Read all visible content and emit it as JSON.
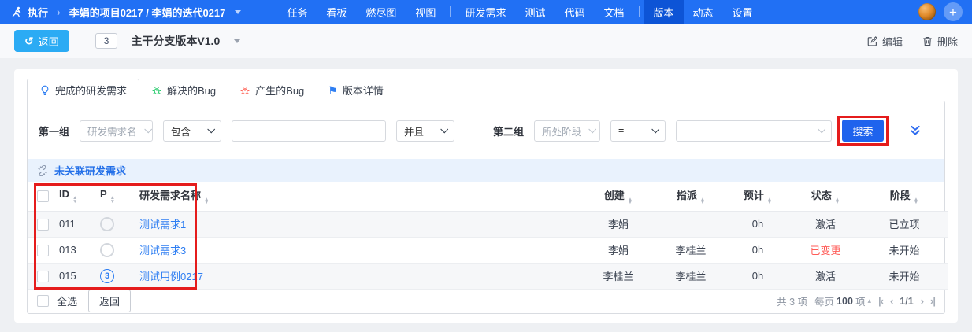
{
  "colors": {
    "navbar": "#2170f4",
    "navbar_active": "#0d54d6",
    "back_button": "#2babf4",
    "search_button": "#1f63ed",
    "link": "#2e7ef2",
    "status_changed": "#ff5b57",
    "section_bar_bg": "#e9f2fd",
    "annotation": "#e51c1c"
  },
  "navbar": {
    "section_label": "执行",
    "breadcrumb": "李娟的项目0217 / 李娟的迭代0217",
    "menu": [
      "任务",
      "看板",
      "燃尽图",
      "视图",
      "研发需求",
      "测试",
      "代码",
      "文档",
      "版本",
      "动态",
      "设置"
    ],
    "active_item": "版本"
  },
  "toolbar": {
    "back_label": "返回",
    "count_badge": "3",
    "version_title": "主干分支版本V1.0",
    "edit_label": "编辑",
    "delete_label": "删除"
  },
  "tabs": [
    {
      "label": "完成的研发需求",
      "icon": "bulb-icon",
      "active": true
    },
    {
      "label": "解决的Bug",
      "icon": "bug-green-icon",
      "active": false
    },
    {
      "label": "产生的Bug",
      "icon": "bug-red-icon",
      "active": false
    },
    {
      "label": "版本详情",
      "icon": "flag-icon",
      "active": false
    }
  ],
  "filter": {
    "group1": {
      "label": "第一组",
      "field": "研发需求名",
      "operator": "包含",
      "value": "",
      "join": "并且"
    },
    "group2": {
      "label": "第二组",
      "field": "所处阶段",
      "operator": "=",
      "value": ""
    },
    "search_label": "搜索"
  },
  "section": {
    "title": "未关联研发需求"
  },
  "table": {
    "headers": {
      "id": "ID",
      "p": "P",
      "name": "研发需求名称",
      "created": "创建",
      "assigned": "指派",
      "estimate": "预计",
      "status": "状态",
      "stage": "阶段"
    },
    "rows": [
      {
        "id": "011",
        "p": "",
        "name": "测试需求1",
        "created": "李娟",
        "assigned": "",
        "estimate": "0h",
        "status": "激活",
        "stage": "已立项"
      },
      {
        "id": "013",
        "p": "",
        "name": "测试需求3",
        "created": "李娟",
        "assigned": "李桂兰",
        "estimate": "0h",
        "status": "已变更",
        "stage": "未开始"
      },
      {
        "id": "015",
        "p": "3",
        "name": "测试用例0217",
        "created": "李桂兰",
        "assigned": "李桂兰",
        "estimate": "0h",
        "status": "激活",
        "stage": "未开始"
      }
    ]
  },
  "footer": {
    "select_all_label": "全选",
    "back_label": "返回",
    "total_text": "共 3 项",
    "per_page_prefix": "每页",
    "per_page_value": "100",
    "per_page_suffix": "项",
    "page_indicator": "1/1",
    "icons": {
      "first": "|‹",
      "prev": "‹",
      "next": "›",
      "last": "›|"
    }
  }
}
